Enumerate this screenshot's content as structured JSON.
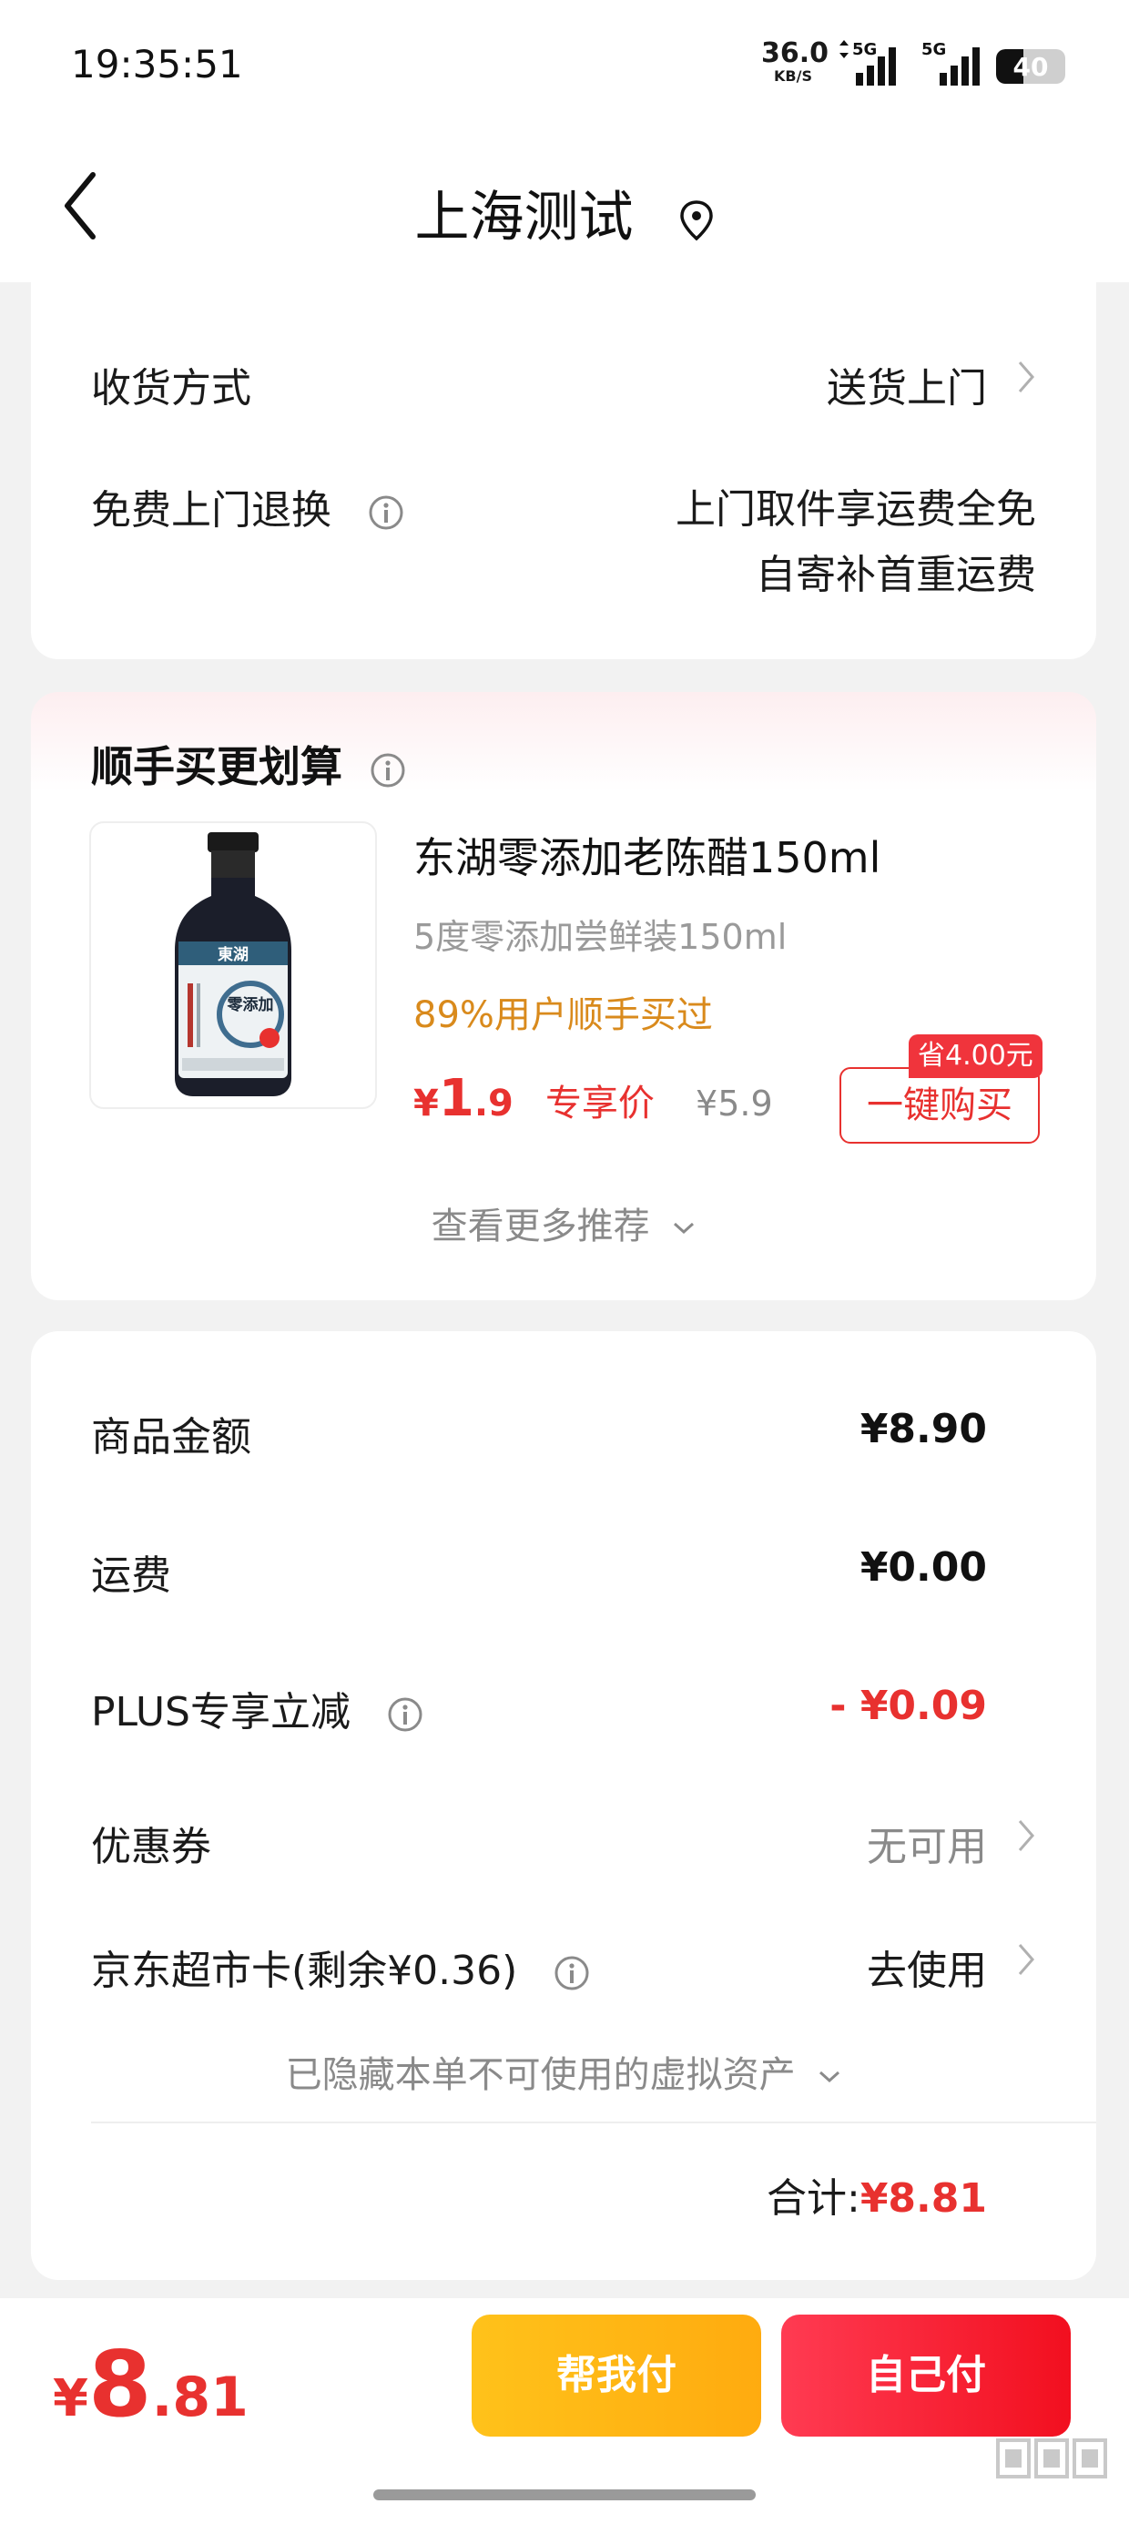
{
  "status_bar": {
    "time": "19:35:51",
    "net_speed": "36.0",
    "net_unit": "KB/S",
    "signal_1": "5G",
    "signal_2": "5G",
    "battery": "40"
  },
  "header": {
    "title": "上海测试"
  },
  "delivery": {
    "method_label": "收货方式",
    "method_value": "送货上门",
    "return_label": "免费上门退换",
    "return_line1": "上门取件享运费全免",
    "return_line2": "自寄补首重运费"
  },
  "recommend": {
    "title": "顺手买更划算",
    "product": {
      "name": "东湖零添加老陈醋150ml",
      "spec": "5度零添加尝鲜装150ml",
      "bought": "89%用户顺手买过",
      "price_yen": "¥",
      "price_int": "1",
      "price_dec": ".9",
      "price_tag": "专享价",
      "original_price": "¥5.9",
      "save_badge": "省4.00元",
      "buy_button": "一键购买",
      "brand": "東湖",
      "label": "零添加"
    },
    "more": "查看更多推荐"
  },
  "summary": {
    "goods_label": "商品金额",
    "goods_value": "¥8.90",
    "shipping_label": "运费",
    "shipping_value": "¥0.00",
    "plus_label": "PLUS专享立减",
    "plus_value": "- ¥0.09",
    "coupon_label": "优惠券",
    "coupon_value": "无可用",
    "card_label": "京东超市卡(剩余¥0.36)",
    "card_value": "去使用",
    "hidden_assets": "已隐藏本单不可使用的虚拟资产",
    "total_label": "合计:",
    "total_value": "¥8.81"
  },
  "bottom": {
    "price_yen": "¥",
    "price_int": "8",
    "price_dec": ".81",
    "help_pay": "帮我付",
    "self_pay": "自己付"
  },
  "colors": {
    "accent_red": "#e8312f",
    "accent_orange": "#d98a1c",
    "help_yellow": "#ffb914",
    "pay_red": "#f8202f"
  }
}
